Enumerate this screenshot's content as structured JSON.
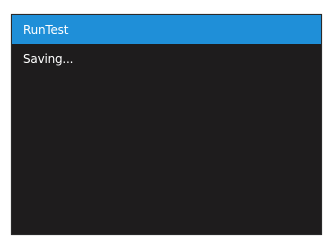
{
  "dialog": {
    "title": "RunTest",
    "message": "Saving...",
    "colors": {
      "titlebar": "#1f8fd8",
      "background": "#1e1c1d",
      "text": "#ffffff"
    }
  }
}
